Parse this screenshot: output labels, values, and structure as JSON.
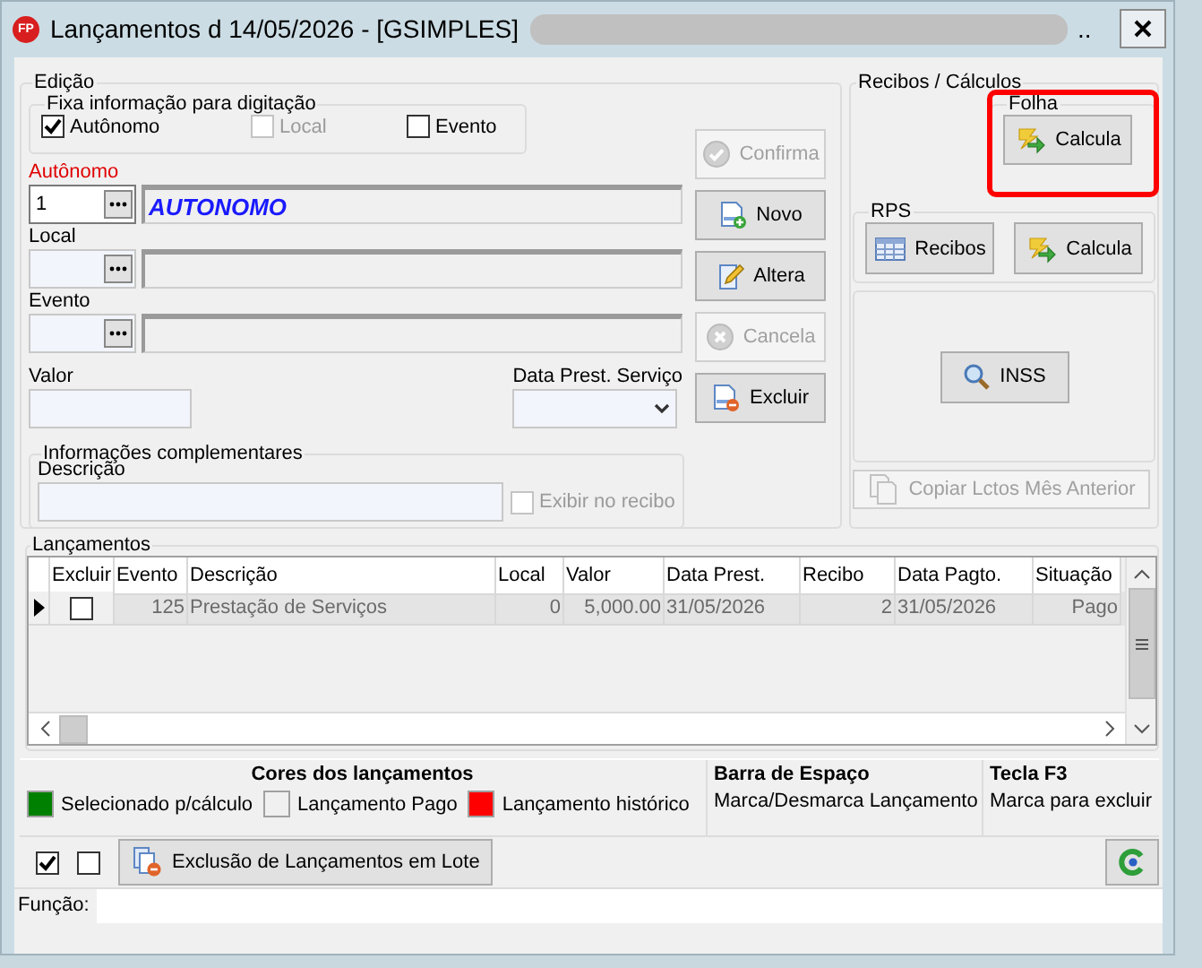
{
  "window": {
    "app_icon": "FP",
    "title": "Lançamentos d 14/05/2026 - [GSIMPLES]",
    "title_tail": ".."
  },
  "edicao": {
    "title": "Edição",
    "fixa": {
      "title": "Fixa informação para digitação",
      "options": [
        {
          "label": "Autônomo",
          "checked": true,
          "disabled": false
        },
        {
          "label": "Local",
          "checked": false,
          "disabled": true
        },
        {
          "label": "Evento",
          "checked": false,
          "disabled": false
        }
      ]
    },
    "lookups": [
      {
        "label": "Autônomo",
        "required": true,
        "disabled": false,
        "code": "1",
        "name": "AUTONOMO"
      },
      {
        "label": "Local",
        "required": false,
        "disabled": true
      },
      {
        "label": "Evento",
        "required": false,
        "disabled": true
      }
    ],
    "valor": {
      "label": "Valor"
    },
    "data_prest": {
      "label": "Data Prest. Serviço"
    },
    "complementares": {
      "title": "Informações complementares",
      "descricao_label": "Descrição",
      "exibir": {
        "label": "Exibir no recibo",
        "checked": false,
        "disabled": true
      }
    },
    "buttons": [
      {
        "label": "Confirma",
        "kind": "confirm",
        "disabled": true
      },
      {
        "label": "Novo",
        "kind": "new",
        "disabled": false
      },
      {
        "label": "Altera",
        "kind": "edit",
        "disabled": false
      },
      {
        "label": "Cancela",
        "kind": "cancel",
        "disabled": true
      },
      {
        "label": "Excluir",
        "kind": "delete",
        "disabled": false
      }
    ]
  },
  "recibos": {
    "title": "Recibos / Cálculos",
    "folha": {
      "title": "Folha",
      "highlighted": true,
      "button": {
        "label": "Calcula"
      }
    },
    "rps": {
      "title": "RPS",
      "buttons": [
        {
          "label": "Recibos",
          "kind": "table"
        },
        {
          "label": "Calcula",
          "kind": "calc"
        }
      ]
    },
    "inss": {
      "label": "INSS"
    },
    "copiar": {
      "label": "Copiar Lctos Mês Anterior",
      "disabled": true
    }
  },
  "grid": {
    "title": "Lançamentos",
    "check_column": "Excluir",
    "columns": [
      "Evento",
      "Descrição",
      "Local",
      "Valor",
      "Data Prest.",
      "Recibo",
      "Data Pagto.",
      "Situação"
    ],
    "rows": [
      {
        "current": true,
        "excluir": false,
        "color": "#e4e4e4",
        "cells": [
          "125",
          "Prestação de Serviços",
          "0",
          "5,000.00",
          "31/05/2026",
          "2",
          "31/05/2026",
          "Pago"
        ]
      }
    ]
  },
  "legend": {
    "title": "Cores dos lançamentos",
    "items": [
      {
        "label": "Selecionado p/cálculo",
        "color": "#008000"
      },
      {
        "label": "Lançamento Pago",
        "color": "#f0f0f0"
      },
      {
        "label": "Lançamento histórico",
        "color": "#ff0000"
      }
    ],
    "keys": [
      {
        "title": "Barra de Espaço",
        "text": "Marca/Desmarca Lançamento"
      },
      {
        "title": "Tecla F3",
        "text": "Marca para excluir"
      }
    ]
  },
  "toolbar": {
    "checks": [
      {
        "checked": true
      },
      {
        "checked": false
      }
    ],
    "lote_button": {
      "label": "Exclusão de Lançamentos em Lote"
    }
  },
  "status_bar": {
    "label": "Função:"
  }
}
